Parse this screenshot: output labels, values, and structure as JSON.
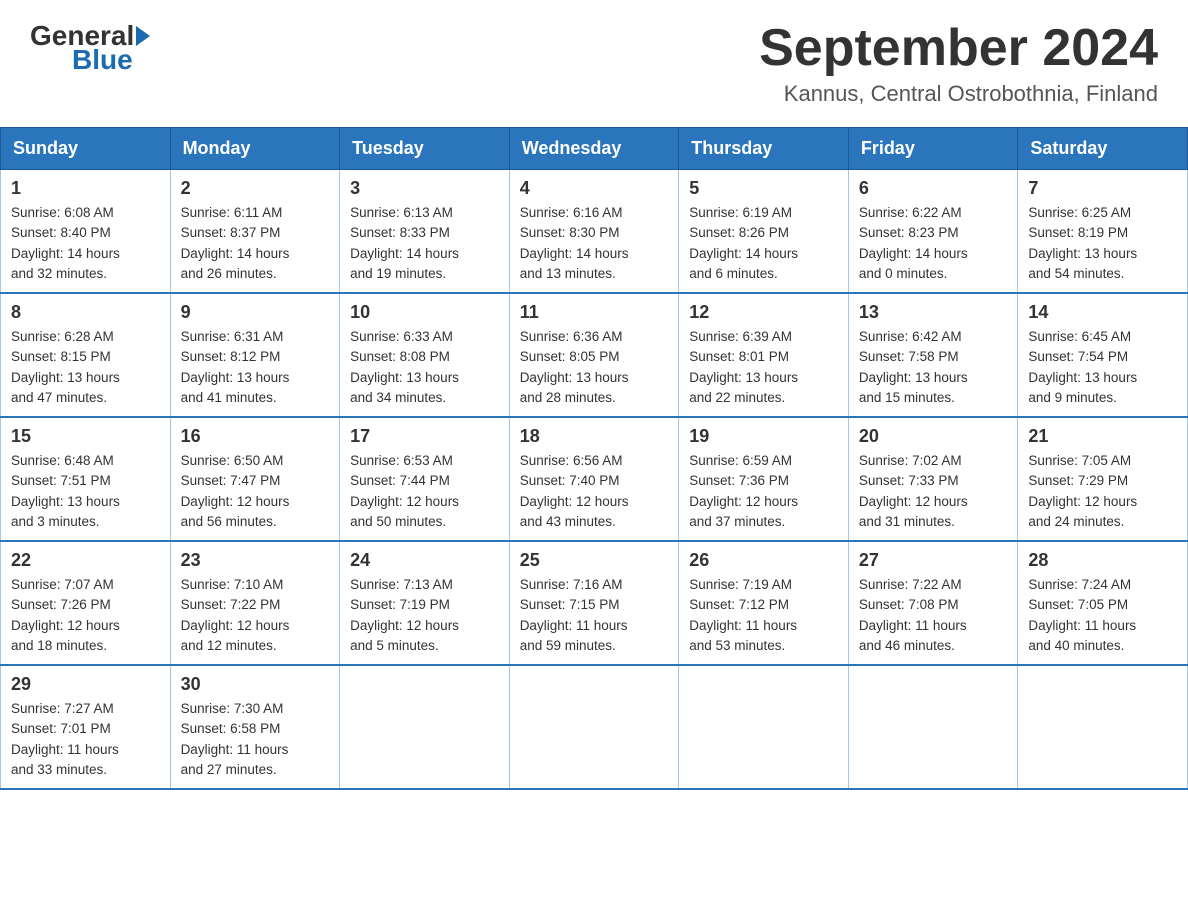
{
  "header": {
    "logo": {
      "general": "General",
      "blue": "Blue"
    },
    "title": "September 2024",
    "location": "Kannus, Central Ostrobothnia, Finland"
  },
  "calendar": {
    "days_of_week": [
      "Sunday",
      "Monday",
      "Tuesday",
      "Wednesday",
      "Thursday",
      "Friday",
      "Saturday"
    ],
    "weeks": [
      [
        {
          "day": 1,
          "info": "Sunrise: 6:08 AM\nSunset: 8:40 PM\nDaylight: 14 hours\nand 32 minutes."
        },
        {
          "day": 2,
          "info": "Sunrise: 6:11 AM\nSunset: 8:37 PM\nDaylight: 14 hours\nand 26 minutes."
        },
        {
          "day": 3,
          "info": "Sunrise: 6:13 AM\nSunset: 8:33 PM\nDaylight: 14 hours\nand 19 minutes."
        },
        {
          "day": 4,
          "info": "Sunrise: 6:16 AM\nSunset: 8:30 PM\nDaylight: 14 hours\nand 13 minutes."
        },
        {
          "day": 5,
          "info": "Sunrise: 6:19 AM\nSunset: 8:26 PM\nDaylight: 14 hours\nand 6 minutes."
        },
        {
          "day": 6,
          "info": "Sunrise: 6:22 AM\nSunset: 8:23 PM\nDaylight: 14 hours\nand 0 minutes."
        },
        {
          "day": 7,
          "info": "Sunrise: 6:25 AM\nSunset: 8:19 PM\nDaylight: 13 hours\nand 54 minutes."
        }
      ],
      [
        {
          "day": 8,
          "info": "Sunrise: 6:28 AM\nSunset: 8:15 PM\nDaylight: 13 hours\nand 47 minutes."
        },
        {
          "day": 9,
          "info": "Sunrise: 6:31 AM\nSunset: 8:12 PM\nDaylight: 13 hours\nand 41 minutes."
        },
        {
          "day": 10,
          "info": "Sunrise: 6:33 AM\nSunset: 8:08 PM\nDaylight: 13 hours\nand 34 minutes."
        },
        {
          "day": 11,
          "info": "Sunrise: 6:36 AM\nSunset: 8:05 PM\nDaylight: 13 hours\nand 28 minutes."
        },
        {
          "day": 12,
          "info": "Sunrise: 6:39 AM\nSunset: 8:01 PM\nDaylight: 13 hours\nand 22 minutes."
        },
        {
          "day": 13,
          "info": "Sunrise: 6:42 AM\nSunset: 7:58 PM\nDaylight: 13 hours\nand 15 minutes."
        },
        {
          "day": 14,
          "info": "Sunrise: 6:45 AM\nSunset: 7:54 PM\nDaylight: 13 hours\nand 9 minutes."
        }
      ],
      [
        {
          "day": 15,
          "info": "Sunrise: 6:48 AM\nSunset: 7:51 PM\nDaylight: 13 hours\nand 3 minutes."
        },
        {
          "day": 16,
          "info": "Sunrise: 6:50 AM\nSunset: 7:47 PM\nDaylight: 12 hours\nand 56 minutes."
        },
        {
          "day": 17,
          "info": "Sunrise: 6:53 AM\nSunset: 7:44 PM\nDaylight: 12 hours\nand 50 minutes."
        },
        {
          "day": 18,
          "info": "Sunrise: 6:56 AM\nSunset: 7:40 PM\nDaylight: 12 hours\nand 43 minutes."
        },
        {
          "day": 19,
          "info": "Sunrise: 6:59 AM\nSunset: 7:36 PM\nDaylight: 12 hours\nand 37 minutes."
        },
        {
          "day": 20,
          "info": "Sunrise: 7:02 AM\nSunset: 7:33 PM\nDaylight: 12 hours\nand 31 minutes."
        },
        {
          "day": 21,
          "info": "Sunrise: 7:05 AM\nSunset: 7:29 PM\nDaylight: 12 hours\nand 24 minutes."
        }
      ],
      [
        {
          "day": 22,
          "info": "Sunrise: 7:07 AM\nSunset: 7:26 PM\nDaylight: 12 hours\nand 18 minutes."
        },
        {
          "day": 23,
          "info": "Sunrise: 7:10 AM\nSunset: 7:22 PM\nDaylight: 12 hours\nand 12 minutes."
        },
        {
          "day": 24,
          "info": "Sunrise: 7:13 AM\nSunset: 7:19 PM\nDaylight: 12 hours\nand 5 minutes."
        },
        {
          "day": 25,
          "info": "Sunrise: 7:16 AM\nSunset: 7:15 PM\nDaylight: 11 hours\nand 59 minutes."
        },
        {
          "day": 26,
          "info": "Sunrise: 7:19 AM\nSunset: 7:12 PM\nDaylight: 11 hours\nand 53 minutes."
        },
        {
          "day": 27,
          "info": "Sunrise: 7:22 AM\nSunset: 7:08 PM\nDaylight: 11 hours\nand 46 minutes."
        },
        {
          "day": 28,
          "info": "Sunrise: 7:24 AM\nSunset: 7:05 PM\nDaylight: 11 hours\nand 40 minutes."
        }
      ],
      [
        {
          "day": 29,
          "info": "Sunrise: 7:27 AM\nSunset: 7:01 PM\nDaylight: 11 hours\nand 33 minutes."
        },
        {
          "day": 30,
          "info": "Sunrise: 7:30 AM\nSunset: 6:58 PM\nDaylight: 11 hours\nand 27 minutes."
        },
        {
          "day": null,
          "info": ""
        },
        {
          "day": null,
          "info": ""
        },
        {
          "day": null,
          "info": ""
        },
        {
          "day": null,
          "info": ""
        },
        {
          "day": null,
          "info": ""
        }
      ]
    ]
  }
}
